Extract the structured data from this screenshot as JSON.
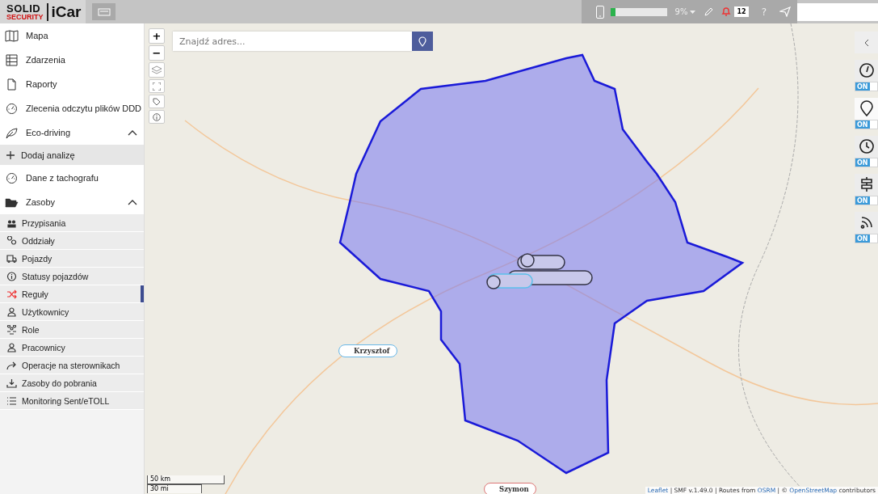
{
  "header": {
    "logo_top": "SOLID",
    "logo_bottom": "SECURITY",
    "logo_app": "iCar",
    "usage": {
      "level": 0.09,
      "reading": "9%"
    },
    "notifications": "12",
    "help": "?"
  },
  "sidebar": {
    "items": [
      {
        "label": "Mapa",
        "kind": "link"
      },
      {
        "label": "Zdarzenia",
        "kind": "link"
      },
      {
        "label": "Raporty",
        "kind": "link"
      },
      {
        "label": "Zlecenia odczytu plików DDD",
        "kind": "link"
      },
      {
        "label": "Eco-driving",
        "kind": "group",
        "expanded": true,
        "children": [
          {
            "label": "Dodaj analizę",
            "kind": "action",
            "selected": false
          }
        ]
      },
      {
        "label": "Dane z tachografu",
        "kind": "link"
      },
      {
        "label": "Zasoby",
        "kind": "group",
        "expanded": true,
        "children": [
          {
            "label": "Przypisania",
            "kind": "sub",
            "selected": false
          },
          {
            "label": "Oddziały",
            "kind": "sub",
            "selected": false
          },
          {
            "label": "Pojazdy",
            "kind": "sub",
            "selected": false
          },
          {
            "label": "Statusy pojazdów",
            "kind": "sub",
            "selected": false
          },
          {
            "label": "Reguły",
            "kind": "sub",
            "selected": true
          },
          {
            "label": "Użytkownicy",
            "kind": "sub",
            "selected": false
          },
          {
            "label": "Role",
            "kind": "sub",
            "selected": false
          },
          {
            "label": "Pracownicy",
            "kind": "sub",
            "selected": false
          },
          {
            "label": "Operacje na sterownikach",
            "kind": "sub",
            "selected": false
          },
          {
            "label": "Zasoby do pobrania",
            "kind": "sub",
            "selected": false
          },
          {
            "label": "Monitoring Sent/eTOLL",
            "kind": "sub",
            "selected": false
          }
        ]
      }
    ]
  },
  "map": {
    "zoom_in": "+",
    "zoom_out": "−",
    "search": {
      "placeholder": "Znajdź adres..."
    },
    "markers": [
      {
        "label": "Krzysztof"
      },
      {
        "label": "Szymon"
      }
    ],
    "scale": [
      "50 km",
      "30 mi"
    ],
    "attribution": [
      {
        "text": "Leaflet",
        "link": true
      },
      {
        "text": "| SMF v.1.49.0 | Routes from",
        "link": false
      },
      {
        "text": "OSRM",
        "link": true
      },
      {
        "text": "| ©",
        "link": false
      },
      {
        "text": "OpenStreetMap",
        "link": true
      },
      {
        "text": "contributors",
        "link": false
      }
    ]
  },
  "layers": [
    {
      "label": "ON",
      "on": true
    },
    {
      "label": "ON",
      "on": true
    },
    {
      "label": "ON",
      "on": true
    },
    {
      "label": "ON",
      "on": true
    },
    {
      "label": "ON",
      "on": true
    }
  ]
}
